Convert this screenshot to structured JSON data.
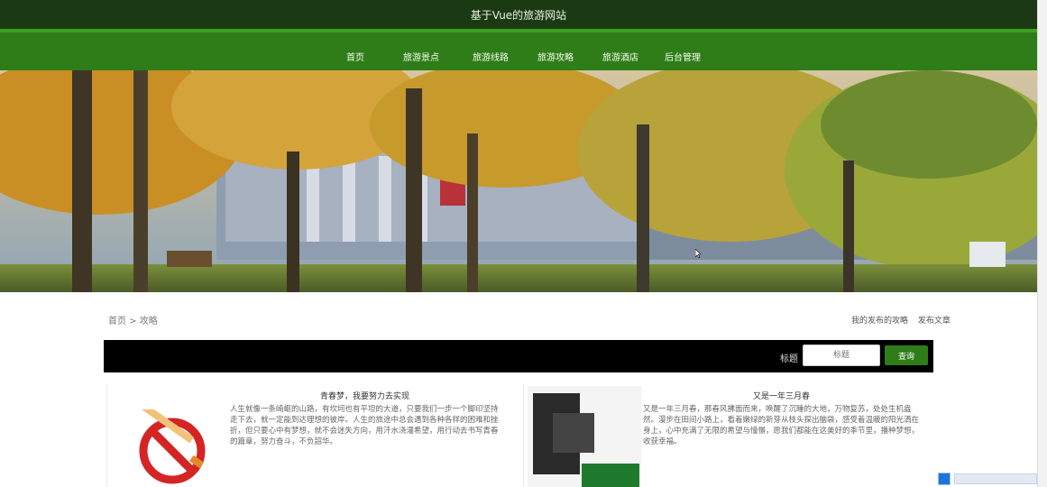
{
  "site_title": "基于Vue的旅游网站",
  "nav": {
    "items": [
      {
        "label": "首页"
      },
      {
        "label": "旅游景点"
      },
      {
        "label": "旅游线路"
      },
      {
        "label": "旅游攻略"
      },
      {
        "label": "旅游酒店"
      },
      {
        "label": "后台管理"
      }
    ]
  },
  "breadcrumb": "首页 > 攻略",
  "links": {
    "my_articles": "我的发布的攻略",
    "publish": "发布文章"
  },
  "search": {
    "label": "标题",
    "placeholder": "标题",
    "button": "查询"
  },
  "articles": [
    {
      "title": "青春梦，我要努力去实现",
      "body": "人生就像一条崎岖的山路，有坎坷也有平坦的大道，只要我们一步一个脚印坚持走下去，就一定能到达理想的彼岸。人生的旅途中总会遇到各种各样的困难和挫折，但只要心中有梦想，就不会迷失方向，用汗水浇灌希望，用行动去书写青春的篇章，努力奋斗，不负韶华。"
    },
    {
      "title": "又是一年三月春",
      "body": "又是一年三月春，那春风拂面而来，唤醒了沉睡的大地，万物复苏，处处生机盎然。漫步在田间小路上，看着嫩绿的新芽从枝头探出脑袋，感受着温暖的阳光洒在身上，心中充满了无限的希望与憧憬，愿我们都能在这美好的季节里，播种梦想，收获幸福。"
    }
  ]
}
